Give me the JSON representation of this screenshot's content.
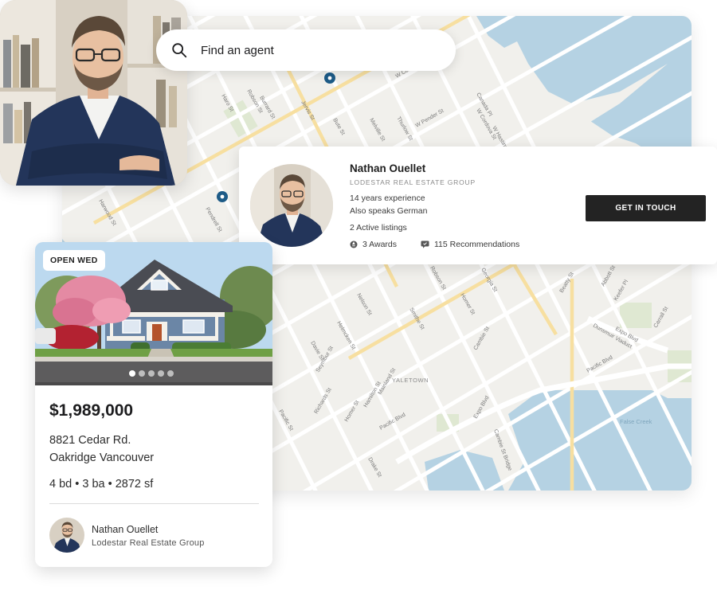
{
  "search": {
    "text": "Find an agent",
    "icon": "search-icon"
  },
  "agent": {
    "name": "Nathan Ouellet",
    "company_caps": "LODESTAR REAL ESTATE GROUP",
    "experience": "14 years experience",
    "languages": "Also speaks German",
    "listings": "2 Active listings",
    "awards": "3 Awards",
    "recommendations": "115 Recommendations",
    "cta_label": "GET IN TOUCH",
    "company": "Lodestar Real Estate Group"
  },
  "listing": {
    "badge": "OPEN WED",
    "price": "$1,989,000",
    "address_line1": "8821 Cedar Rd.",
    "address_line2": "Oakridge Vancouver",
    "specs": "4 bd • 3 ba • 2872 sf",
    "photo_count": 5,
    "active_photo": 1
  },
  "map": {
    "area_label": "YALETOWN",
    "water_label": "False Creek",
    "streets": [
      "W Cordova St",
      "Robson St",
      "Burrard St",
      "Hornby St",
      "Howe St",
      "Jervis St",
      "Bute St",
      "Thurlow St",
      "Melville St",
      "W Pender St",
      "Canada Pl",
      "W Cordova St",
      "W Hastings St",
      "Haro St",
      "Harwood St",
      "Pendrell St",
      "Nelson St",
      "Helmcken St",
      "Davie St",
      "Seymour St",
      "Richards St",
      "Homer St",
      "Hamilton St",
      "Mainland St",
      "Pacific St",
      "Pacific Blvd",
      "Smithe St",
      "Robson St",
      "Georgia St",
      "Beatty St",
      "Cambie St",
      "Expo Blvd",
      "Dunsmuir Viaduct",
      "Keefer Pl",
      "Abbott St",
      "Carrall St",
      "Pacific Blvd",
      "Drake St",
      "Cambie St Bridge"
    ]
  },
  "colors": {
    "water": "#b5d2e3",
    "road_major": "#f7dfa0",
    "cta_bg": "#232323",
    "map_bg": "#f1f0ec"
  }
}
